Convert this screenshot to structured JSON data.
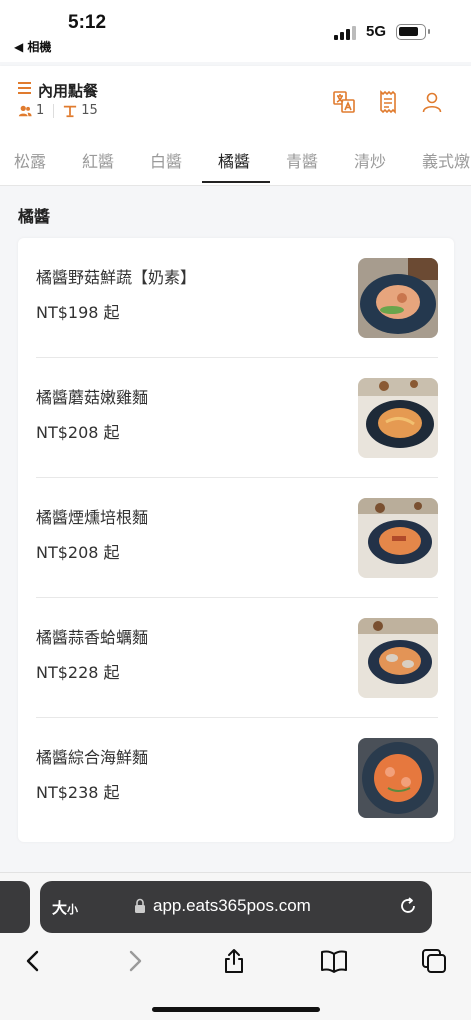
{
  "status_bar": {
    "time": "5:12",
    "back_label": "◀ 相機",
    "network": "5G"
  },
  "header": {
    "title": "內用點餐",
    "guests": "1",
    "table": "15",
    "icons": [
      "menu-icon",
      "people-icon",
      "table-icon",
      "translate-icon",
      "receipt-icon",
      "user-icon"
    ],
    "accent_color": "#e07b2e"
  },
  "tabs": [
    {
      "label": "松露",
      "active": false
    },
    {
      "label": "紅醬",
      "active": false
    },
    {
      "label": "白醬",
      "active": false
    },
    {
      "label": "橘醬",
      "active": true
    },
    {
      "label": "青醬",
      "active": false
    },
    {
      "label": "清炒",
      "active": false
    },
    {
      "label": "義式燉",
      "active": false
    }
  ],
  "section": {
    "title": "橘醬",
    "items": [
      {
        "name": "橘醬野菇鮮蔬【奶素】",
        "price": "NT$198 起"
      },
      {
        "name": "橘醬蘑菇嫩雞麵",
        "price": "NT$208 起"
      },
      {
        "name": "橘醬煙燻培根麵",
        "price": "NT$208 起"
      },
      {
        "name": "橘醬蒜香蛤蠣麵",
        "price": "NT$228 起"
      },
      {
        "name": "橘醬綜合海鮮麵",
        "price": "NT$238 起"
      }
    ]
  },
  "browser": {
    "text_size_big": "大",
    "text_size_small": "小",
    "url": "app.eats365pos.com",
    "icons": [
      "lock-icon",
      "reload-icon",
      "back-arrow-icon",
      "forward-arrow-icon",
      "share-icon",
      "bookmarks-icon",
      "tabs-icon"
    ]
  }
}
